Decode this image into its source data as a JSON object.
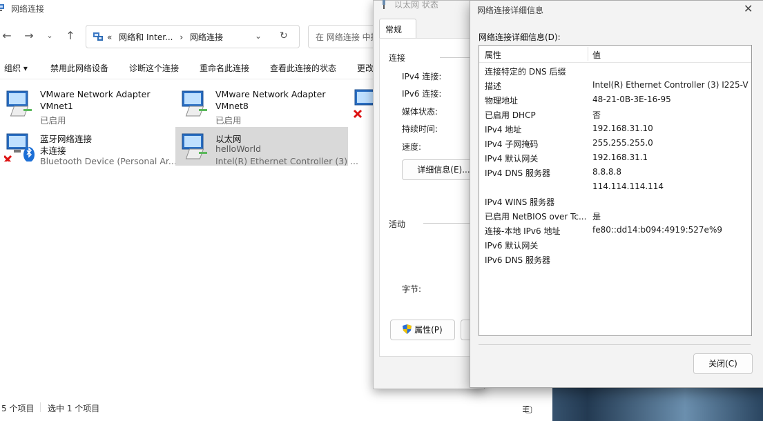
{
  "explorer": {
    "title": "网络连接",
    "address": {
      "root": "«",
      "crumbs": [
        "网络和 Inter...",
        "›",
        "网络连接"
      ]
    },
    "search_placeholder": "在 网络连接 中搜",
    "toolbar": [
      "组织 ▾",
      "禁用此网络设备",
      "诊断这个连接",
      "重命名此连接",
      "查看此连接的状态",
      "更改"
    ],
    "items": [
      {
        "l1": "VMware Network Adapter",
        "l2": "VMnet1",
        "l3": "已启用"
      },
      {
        "l1": "VMware Network Adapter",
        "l2": "VMnet8",
        "l3": "已启用"
      },
      {
        "l1": "蓝牙网络连接",
        "l2": "未连接",
        "l3": "Bluetooth Device (Personal Ar..."
      },
      {
        "l1": "以太网",
        "l2": "helloWorld",
        "l3": "Intel(R) Ethernet Controller (3) ..."
      }
    ],
    "status": {
      "count": "5 个项目",
      "selected": "选中 1 个项目"
    }
  },
  "status_dialog": {
    "title": "以太网 状态",
    "tab": "常规",
    "section_connection": "连接",
    "labels": [
      "IPv4 连接:",
      "IPv6 连接:",
      "媒体状态:",
      "持续时间:",
      "速度:"
    ],
    "details_button": "详细信息(E)...",
    "section_activity": "活动",
    "bytes_label": "字节:",
    "properties_button": "属性(P)"
  },
  "details_dialog": {
    "title": "网络连接详细信息",
    "caption": "网络连接详细信息(D):",
    "col_property": "属性",
    "col_value": "值",
    "rows": [
      {
        "p": "连接特定的 DNS 后缀",
        "v": ""
      },
      {
        "p": "描述",
        "v": "Intel(R) Ethernet Controller (3) I225-V"
      },
      {
        "p": "物理地址",
        "v": "48-21-0B-3E-16-95"
      },
      {
        "p": "已启用 DHCP",
        "v": "否"
      },
      {
        "p": "IPv4 地址",
        "v": "192.168.31.10"
      },
      {
        "p": "IPv4 子网掩码",
        "v": "255.255.255.0"
      },
      {
        "p": "IPv4 默认网关",
        "v": "192.168.31.1"
      },
      {
        "p": "IPv4 DNS 服务器",
        "v": "8.8.8.8"
      },
      {
        "p": "",
        "v": "114.114.114.114"
      },
      {
        "p": "IPv4 WINS 服务器",
        "v": ""
      },
      {
        "p": "已启用 NetBIOS over Tc...",
        "v": "是"
      },
      {
        "p": "连接-本地 IPv6 地址",
        "v": "fe80::dd14:b094:4919:527e%9"
      },
      {
        "p": "IPv6 默认网关",
        "v": ""
      },
      {
        "p": "IPv6 DNS 服务器",
        "v": ""
      }
    ],
    "close_button": "关闭(C)"
  }
}
